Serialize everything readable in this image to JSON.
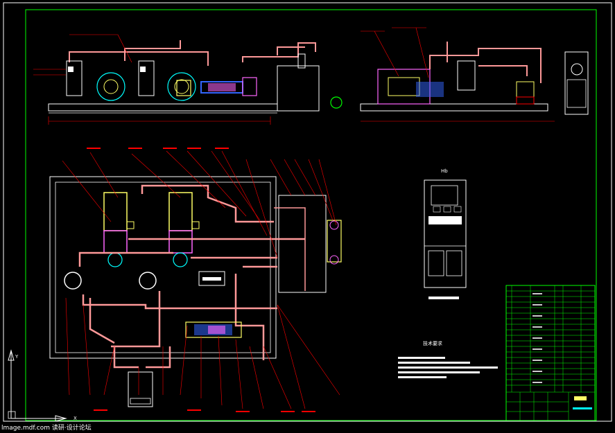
{
  "drawing": {
    "cabinet_title": "Hb",
    "tech_requirements_title": "技术要求",
    "ucs_x": "X",
    "ucs_y": "Y"
  },
  "status_bar": {
    "text": "lmage.mdf.com 读研·设计论坛"
  },
  "colors": {
    "background": "#000000",
    "frame": "#00ff00",
    "pipe": "#ff9999",
    "leader": "#ff0000",
    "equipment": "#ffffff",
    "motor": "#ffff66",
    "pump": "#ff66ff",
    "accent_blue": "#3366ff",
    "accent_cyan": "#00ffff"
  }
}
